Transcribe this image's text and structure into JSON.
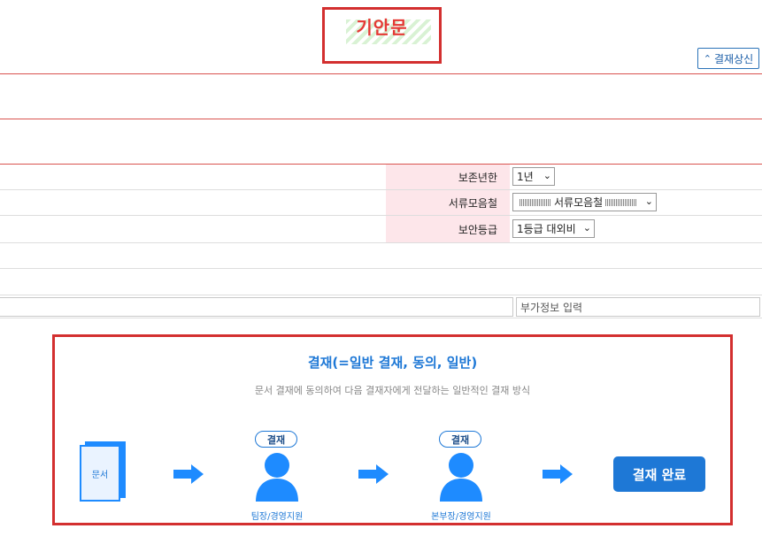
{
  "header": {
    "title": "기안문",
    "resubmit_button": "결재상신"
  },
  "form": {
    "retention": {
      "label": "보존년한",
      "value": "1년"
    },
    "folder": {
      "label": "서류모음철",
      "value": "서류모음철"
    },
    "security": {
      "label": "보안등급",
      "value": "1등급 대외비"
    },
    "extra_info_placeholder": "부가정보 입력"
  },
  "process": {
    "title": "결재(=일반 결재, 동의, 일반)",
    "subtitle": "문서 결재에 동의하여 다음 결재자에게 전달하는 일반적인 결재 방식",
    "document_label": "문서",
    "steps": [
      {
        "badge": "결재",
        "label": "팀장/경영지원"
      },
      {
        "badge": "결재",
        "label": "본부장/경영지원"
      }
    ],
    "complete_label": "결재 완료"
  },
  "colors": {
    "accent": "#1e78d6",
    "title_red": "#e53935",
    "label_bg": "#fde6ea"
  }
}
